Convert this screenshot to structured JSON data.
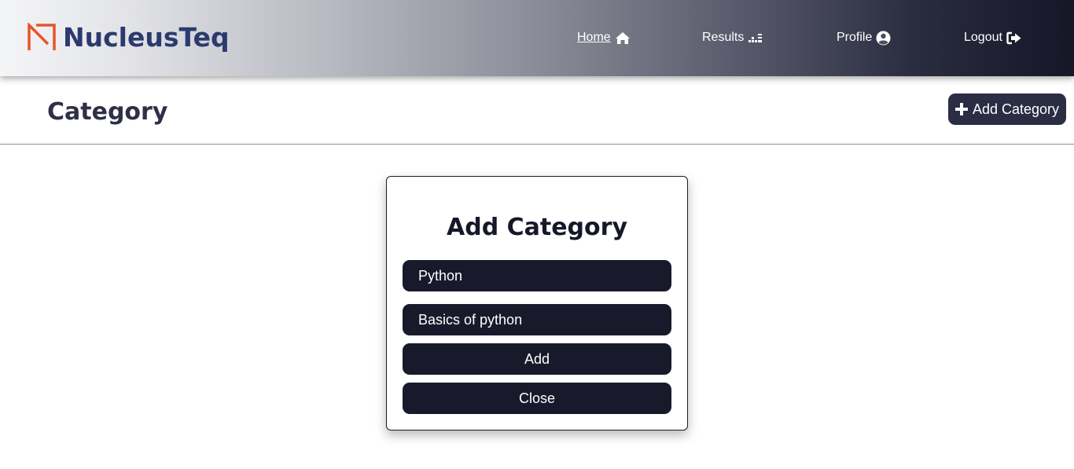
{
  "brand": {
    "name": "NucleusTeq",
    "colors": {
      "text": "#2b3a6e",
      "mark": "#e8542a"
    }
  },
  "nav": {
    "items": [
      {
        "label": "Home",
        "icon": "home-icon",
        "active": true
      },
      {
        "label": "Results",
        "icon": "results-icon",
        "active": false
      },
      {
        "label": "Profile",
        "icon": "user-circle-icon",
        "active": false
      },
      {
        "label": "Logout",
        "icon": "logout-icon",
        "active": false
      }
    ]
  },
  "page": {
    "title": "Category",
    "add_button_label": "Add Category"
  },
  "modal": {
    "title": "Add Category",
    "name_value": "Python",
    "description_value": "Basics of python",
    "add_label": "Add",
    "close_label": "Close"
  },
  "colors": {
    "accent_dark": "#181a2c",
    "button": "#2b2d45",
    "title_text": "#2e3045"
  }
}
